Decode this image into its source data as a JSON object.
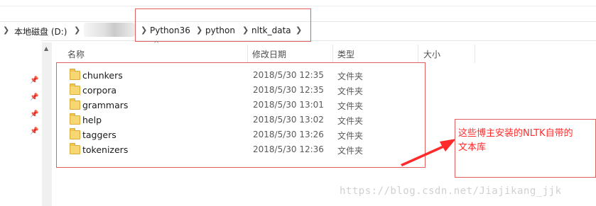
{
  "address_bar": {
    "segments": [
      "本地磁盘 (D:)",
      "Python36",
      "python",
      "nltk_data"
    ]
  },
  "columns": {
    "name": "名称",
    "date": "修改日期",
    "type": "类型",
    "size": "大小"
  },
  "rows": [
    {
      "name": "chunkers",
      "date": "2018/5/30 12:35",
      "type": "文件夹"
    },
    {
      "name": "corpora",
      "date": "2018/5/30 12:35",
      "type": "文件夹"
    },
    {
      "name": "grammars",
      "date": "2018/5/30 13:01",
      "type": "文件夹"
    },
    {
      "name": "help",
      "date": "2018/5/30 13:02",
      "type": "文件夹"
    },
    {
      "name": "taggers",
      "date": "2018/5/30 13:26",
      "type": "文件夹"
    },
    {
      "name": "tokenizers",
      "date": "2018/5/30 12:36",
      "type": "文件夹"
    }
  ],
  "annotation": {
    "line1": "这些博主安装的NLTK自带的",
    "line2": "文本库",
    "color": "#ff2a2a"
  },
  "watermark": "https://blog.csdn.net/Jiajikang_jjk"
}
